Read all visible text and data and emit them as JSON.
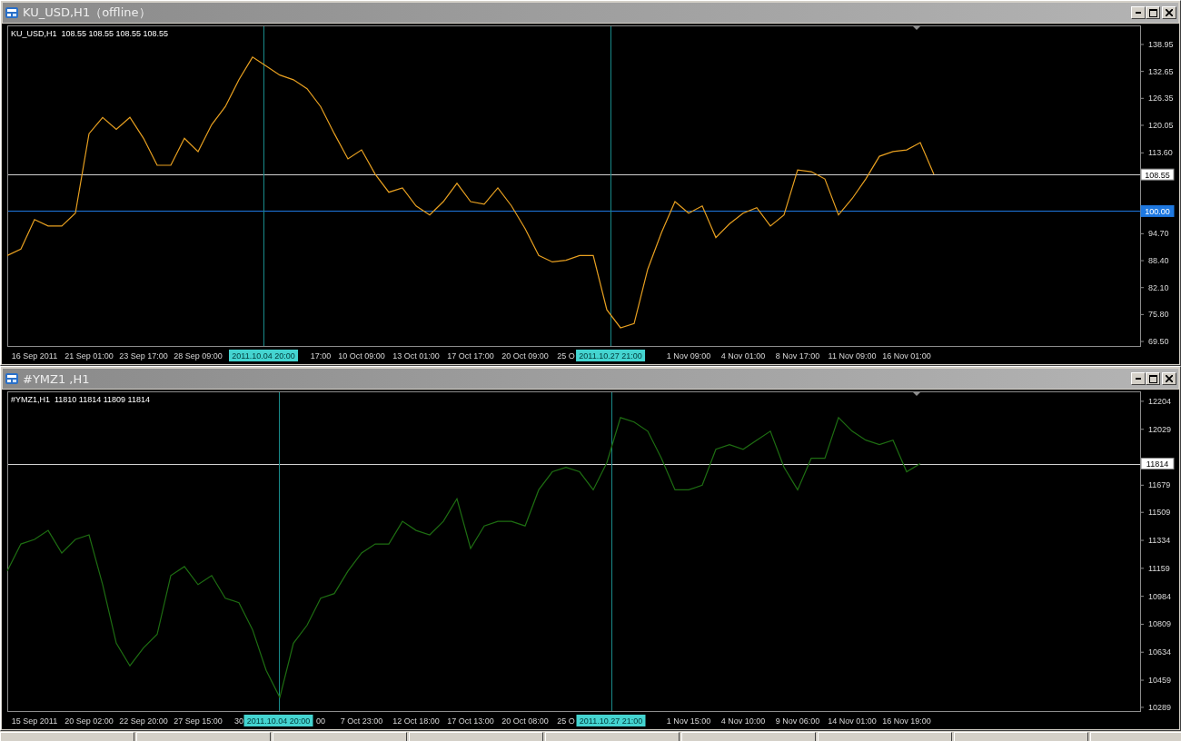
{
  "windows": [
    {
      "title": "KU_USD,H1（offline）",
      "header": "KU_USD,H1  108.55 108.55 108.55 108.55",
      "chart_data": {
        "type": "line",
        "ylim": [
          68.45,
          143.4
        ],
        "yticks": [
          138.95,
          132.65,
          126.35,
          120.05,
          {
            "value": 113.6,
            "label": "113.60"
          },
          {
            "value": 94.7,
            "label": "94.70"
          },
          {
            "value": 88.4,
            "label": "88.40"
          },
          {
            "value": 82.1,
            "label": "82.10"
          },
          {
            "value": 75.8,
            "label": "75.80"
          },
          {
            "value": 69.5,
            "label": "69.50"
          }
        ],
        "categories": [
          null,
          null,
          "16 Sep 2011",
          null,
          null,
          null,
          "21 Sep 01:00",
          null,
          null,
          null,
          "23 Sep 17:00",
          null,
          null,
          null,
          "28 Sep 09:00",
          null,
          null,
          null,
          null,
          null,
          null,
          null,
          null,
          "17:00",
          null,
          null,
          "10 Oct 09:00",
          null,
          null,
          null,
          "13 Oct 01:00",
          null,
          null,
          null,
          "17 Oct 17:00",
          null,
          null,
          null,
          "20 Oct 09:00",
          null,
          null,
          "25 O",
          null,
          null,
          null,
          null,
          null,
          null,
          null,
          null,
          "1 Nov 09:00",
          null,
          null,
          null,
          "4 Nov 01:00",
          null,
          null,
          null,
          "8 Nov 17:00",
          null,
          null,
          null,
          "11 Nov 09:00",
          null,
          null,
          null,
          "16 Nov 01:00",
          null,
          null
        ],
        "series": [
          {
            "color": "#e8a020",
            "values": [
              89.6,
              91.1,
              98.0,
              96.5,
              96.5,
              99.5,
              118.1,
              121.9,
              119.1,
              121.9,
              117.0,
              110.7,
              110.7,
              117.0,
              113.9,
              120.2,
              124.4,
              130.7,
              136.0,
              133.9,
              131.8,
              130.7,
              128.6,
              124.4,
              118.1,
              112.2,
              114.3,
              108.6,
              104.4,
              105.4,
              101.2,
              99.1,
              102.2,
              106.5,
              102.2,
              101.6,
              105.4,
              101.2,
              95.9,
              89.6,
              88.1,
              88.5,
              89.6,
              89.6,
              76.9,
              72.7,
              73.7,
              86.4,
              94.9,
              102.2,
              99.5,
              101.2,
              93.8,
              97.0,
              99.5,
              100.8,
              96.5,
              99.1,
              109.6,
              109.2,
              107.5,
              99.1,
              102.9,
              107.5,
              112.8,
              113.9,
              114.3,
              116.0,
              108.6
            ]
          }
        ],
        "ref_lines": [
          {
            "axis": "y",
            "value": 108.55,
            "label": "108.55",
            "color": "#d0d0d0"
          },
          {
            "axis": "y",
            "value": 100,
            "label": "100.00",
            "color": "#1e78e0"
          }
        ],
        "annotations": [
          "2011.10.04 20:00",
          "2011.10.27 21:00"
        ]
      }
    },
    {
      "title": "#YMZ1 ,H1",
      "header": "#YMZ1,H1  11810 11814 11809 11814",
      "chart_data": {
        "type": "line",
        "ylim": [
          10266,
          12266
        ],
        "yticks": [
          12204,
          12029,
          11679,
          11509,
          11334,
          11159,
          10984,
          10809,
          10634,
          10459,
          10289
        ],
        "categories": [
          null,
          null,
          "15 Sep 2011",
          null,
          null,
          null,
          "20 Sep 02:00",
          null,
          null,
          null,
          "22 Sep 20:00",
          null,
          null,
          null,
          "27 Sep 15:00",
          null,
          null,
          "30",
          null,
          null,
          null,
          null,
          null,
          "00",
          null,
          null,
          "7 Oct 23:00",
          null,
          null,
          null,
          "12 Oct 18:00",
          null,
          null,
          null,
          "17 Oct 13:00",
          null,
          null,
          null,
          "20 Oct 08:00",
          null,
          null,
          "25 O",
          null,
          null,
          null,
          null,
          null,
          null,
          null,
          null,
          "1 Nov 15:00",
          null,
          null,
          null,
          "4 Nov 10:00",
          null,
          null,
          null,
          "9 Nov 06:00",
          null,
          null,
          null,
          "14 Nov 01:00",
          null,
          null,
          null,
          "16 Nov 19:00",
          null
        ],
        "series": [
          {
            "color": "#1e6e12",
            "values": [
              11142,
              11311,
              11340,
              11396,
              11255,
              11340,
              11368,
              11057,
              10690,
              10549,
              10662,
              10746,
              11114,
              11170,
              11057,
              11114,
              10972,
              10944,
              10775,
              10520,
              10351,
              10690,
              10803,
              10972,
              11001,
              11142,
              11255,
              11311,
              11311,
              11453,
              11396,
              11368,
              11453,
              11594,
              11283,
              11424,
              11453,
              11453,
              11424,
              11650,
              11763,
              11791,
              11763,
              11650,
              11820,
              12102,
              12074,
              12017,
              11848,
              11650,
              11650,
              11679,
              11904,
              11933,
              11904,
              11961,
              12017,
              11791,
              11650,
              11848,
              11848,
              12102,
              12017,
              11961,
              11933,
              11961,
              11763,
              11814
            ]
          }
        ],
        "ref_lines": [
          {
            "axis": "y",
            "value": 11814,
            "label": "11814",
            "color": "#d0d0d0"
          }
        ],
        "annotations": [
          "2011.10.04 20:00",
          "2011.10.27 21:00"
        ]
      }
    }
  ]
}
